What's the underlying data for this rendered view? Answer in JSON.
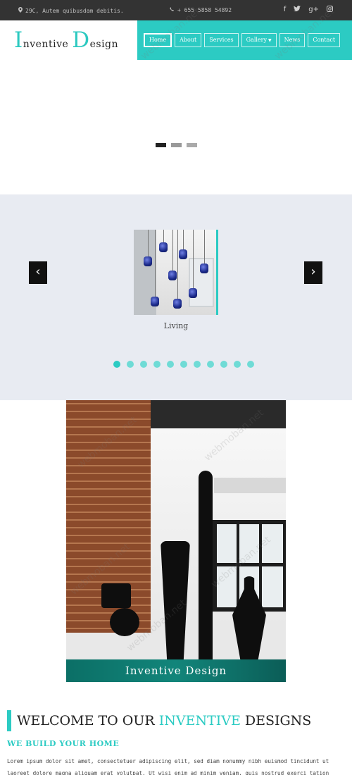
{
  "topbar": {
    "address": "29C, Autem quibusdam debitis.",
    "phone": "+ 655 5858 54892",
    "social": [
      {
        "icon": "facebook-icon",
        "glyph": "f"
      },
      {
        "icon": "twitter-icon",
        "glyph": "🐦"
      },
      {
        "icon": "google-plus-icon",
        "glyph": "g+"
      },
      {
        "icon": "instagram-icon",
        "glyph": "◙"
      }
    ]
  },
  "logo": {
    "initial1": "I",
    "rest1": "nventive ",
    "initial2": "D",
    "rest2": "esign"
  },
  "nav": {
    "items": [
      {
        "label": "Home",
        "active": true
      },
      {
        "label": "About"
      },
      {
        "label": "Services"
      },
      {
        "label": "Gallery",
        "dropdown": true
      },
      {
        "label": "News"
      },
      {
        "label": "Contact"
      }
    ]
  },
  "hero": {
    "dots": 3,
    "active_dot": 0
  },
  "carousel": {
    "prev_glyph": "‹",
    "next_glyph": "›",
    "item_label": "Living",
    "dots": 11,
    "active_dot": 0
  },
  "feature": {
    "caption": "Inventive Design"
  },
  "welcome": {
    "title_prefix": "WELCOME TO OUR ",
    "title_accent": "INVENTIVE",
    "title_suffix": " DESIGNS",
    "subheading": "WE BUILD YOUR HOME",
    "paragraph": "Lorem ipsum dolor sit amet, consectetuer adipiscing elit, sed diam nonummy nibh euismod tincidunt ut laoreet dolore magna aliquam erat volutpat. Ut wisi enim ad minim veniam, quis nostrud exerci tation ullamcorper"
  },
  "watermark": "webmoban.net",
  "colors": {
    "accent": "#2ccbc3",
    "topbar": "#333333",
    "carousel_bg": "#e8ebf2"
  }
}
